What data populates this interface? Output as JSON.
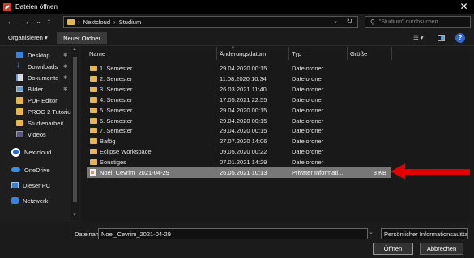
{
  "window": {
    "title": "Dateien öffnen",
    "close_glyph": "✕"
  },
  "nav": {
    "back": "←",
    "forward": "→",
    "recent": "⌄",
    "up": "↑",
    "path": [
      "Nextcloud",
      "Studium"
    ],
    "refresh": "↻",
    "search_placeholder": "\"Studium\" durchsuchen"
  },
  "toolbar": {
    "organize": "Organisieren ▾",
    "new_folder": "Neuer Ordner",
    "view": "☷ ▾",
    "help": "?"
  },
  "sidebar": {
    "items": [
      {
        "label": "Desktop",
        "icon": "desktop-icon",
        "pinned": true
      },
      {
        "label": "Downloads",
        "icon": "download-icon",
        "pinned": true
      },
      {
        "label": "Dokumente",
        "icon": "documents-icon",
        "pinned": true
      },
      {
        "label": "Bilder",
        "icon": "pictures-icon",
        "pinned": true
      },
      {
        "label": "PDF Editor",
        "icon": "folder-icon",
        "pinned": false
      },
      {
        "label": "PROG 2 Tutoriur",
        "icon": "folder-icon",
        "pinned": false
      },
      {
        "label": "Studienarbeit",
        "icon": "folder-icon",
        "pinned": false
      },
      {
        "label": "Videos",
        "icon": "video-icon",
        "pinned": false
      },
      {
        "label": "Nextcloud",
        "icon": "nextcloud-icon",
        "pinned": false
      },
      {
        "label": "OneDrive",
        "icon": "onedrive-icon",
        "pinned": false
      },
      {
        "label": "Dieser PC",
        "icon": "pc-icon",
        "pinned": false
      },
      {
        "label": "Netzwerk",
        "icon": "network-icon",
        "pinned": false
      }
    ],
    "pin_glyph": "✱"
  },
  "columns": {
    "name": "Name",
    "date": "Änderungsdatum",
    "type": "Typ",
    "size": "Größe",
    "sort_glyph": "^"
  },
  "files": [
    {
      "name": "1. Semester",
      "date": "29.04.2020 00:15",
      "type": "Dateiordner",
      "size": "",
      "kind": "folder"
    },
    {
      "name": "2. Semester",
      "date": "11.08.2020 10:34",
      "type": "Dateiordner",
      "size": "",
      "kind": "folder"
    },
    {
      "name": "3. Semester",
      "date": "26.03.2021 11:40",
      "type": "Dateiordner",
      "size": "",
      "kind": "folder"
    },
    {
      "name": "4. Semester",
      "date": "17.05.2021 22:55",
      "type": "Dateiordner",
      "size": "",
      "kind": "folder"
    },
    {
      "name": "5. Semester",
      "date": "29.04.2020 00:15",
      "type": "Dateiordner",
      "size": "",
      "kind": "folder"
    },
    {
      "name": "6. Semester",
      "date": "29.04.2020 00:15",
      "type": "Dateiordner",
      "size": "",
      "kind": "folder"
    },
    {
      "name": "7. Semester",
      "date": "29.04.2020 00:15",
      "type": "Dateiordner",
      "size": "",
      "kind": "folder"
    },
    {
      "name": "Bafög",
      "date": "27.07.2020 14:06",
      "type": "Dateiordner",
      "size": "",
      "kind": "folder"
    },
    {
      "name": "Eclipse Workspace",
      "date": "09.05.2020 00:22",
      "type": "Dateiordner",
      "size": "",
      "kind": "folder"
    },
    {
      "name": "Sonstiges",
      "date": "07.01.2021 14:29",
      "type": "Dateiordner",
      "size": "",
      "kind": "folder"
    },
    {
      "name": "Noel_Cevrim_2021-04-29",
      "date": "26.05.2021 10:13",
      "type": "Privater Informati...",
      "size": "8 KB",
      "kind": "file",
      "selected": true
    }
  ],
  "bottom": {
    "filename_label": "Dateiname:",
    "filename_value": "Noel_Cevrim_2021-04-29",
    "filetype_value": "Persönlicher Informationsausta",
    "dropdown_glyph": "⌄",
    "open_label": "Öffnen",
    "cancel_label": "Abbrechen"
  },
  "colors": {
    "accent_arrow": "#e10000",
    "folder": "#e8b64c",
    "selection": "#777777"
  }
}
